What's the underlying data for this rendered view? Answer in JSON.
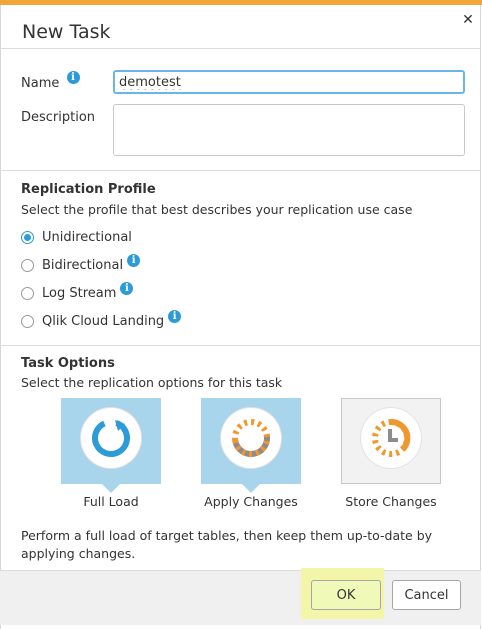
{
  "dialog": {
    "title": "New Task",
    "close_glyph": "✕"
  },
  "fields": {
    "name_label": "Name",
    "name_value": "demotest",
    "description_label": "Description",
    "description_value": ""
  },
  "info_glyph": "i",
  "replication_profile": {
    "title": "Replication Profile",
    "subtitle": "Select the profile that best describes your replication use case",
    "options": [
      {
        "label": "Unidirectional",
        "selected": true,
        "info": false
      },
      {
        "label": "Bidirectional",
        "selected": false,
        "info": true
      },
      {
        "label": "Log Stream",
        "selected": false,
        "info": true
      },
      {
        "label": "Qlik Cloud Landing",
        "selected": false,
        "info": true
      }
    ]
  },
  "task_options": {
    "title": "Task Options",
    "subtitle": "Select the replication options for this task",
    "tiles": [
      {
        "label": "Full Load",
        "selected": true,
        "icon": "full-load-icon"
      },
      {
        "label": "Apply Changes",
        "selected": true,
        "icon": "apply-changes-icon"
      },
      {
        "label": "Store Changes",
        "selected": false,
        "icon": "store-changes-icon"
      }
    ],
    "description": "Perform a full load of target tables, then keep them up-to-date by applying changes."
  },
  "footer": {
    "ok_label": "OK",
    "cancel_label": "Cancel"
  },
  "colors": {
    "accent_blue": "#2d9bd7",
    "tile_selected": "#a9d5ec",
    "orange": "#f0972f",
    "ok_highlight": "#f3f5a8",
    "top_bar": "#f0a63a"
  }
}
